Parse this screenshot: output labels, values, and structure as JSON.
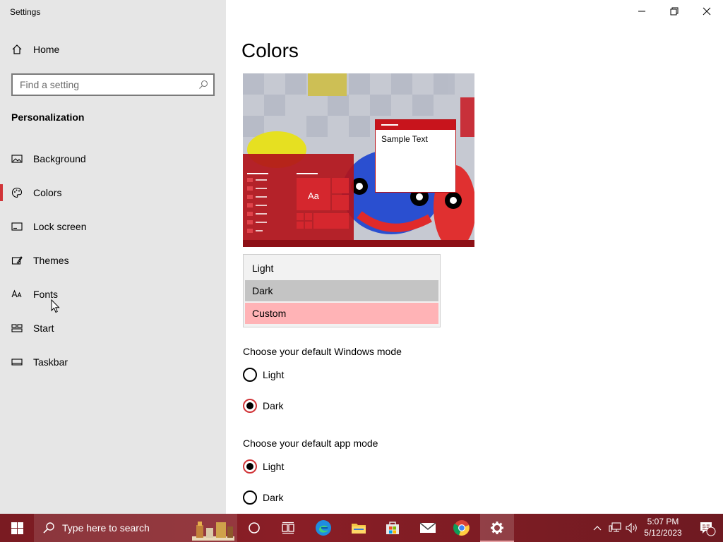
{
  "window": {
    "title": "Settings"
  },
  "sidebar": {
    "home_label": "Home",
    "search_placeholder": "Find a setting",
    "section_title": "Personalization",
    "items": [
      {
        "label": "Background",
        "icon": "picture-icon"
      },
      {
        "label": "Colors",
        "icon": "palette-icon",
        "selected": true
      },
      {
        "label": "Lock screen",
        "icon": "lock-screen-icon"
      },
      {
        "label": "Themes",
        "icon": "themes-icon"
      },
      {
        "label": "Fonts",
        "icon": "fonts-icon"
      },
      {
        "label": "Start",
        "icon": "start-icon"
      },
      {
        "label": "Taskbar",
        "icon": "taskbar-icon"
      }
    ]
  },
  "main": {
    "title": "Colors",
    "preview": {
      "sample_text": "Sample Text",
      "tile_text": "Aa"
    },
    "color_dropdown": {
      "options": [
        "Light",
        "Dark",
        "Custom"
      ],
      "selected": "Custom"
    },
    "windows_mode": {
      "label": "Choose your default Windows mode",
      "options": [
        "Light",
        "Dark"
      ],
      "selected": "Dark"
    },
    "app_mode": {
      "label": "Choose your default app mode",
      "options": [
        "Light",
        "Dark"
      ],
      "selected": "Light"
    }
  },
  "taskbar": {
    "search_placeholder": "Type here to search",
    "time": "5:07 PM",
    "date": "5/12/2023",
    "notification_count": "1"
  },
  "colors": {
    "accent": "#d13438",
    "sidebar_bg": "#e6e6e6",
    "taskbar_bg": "#7a1b22"
  }
}
